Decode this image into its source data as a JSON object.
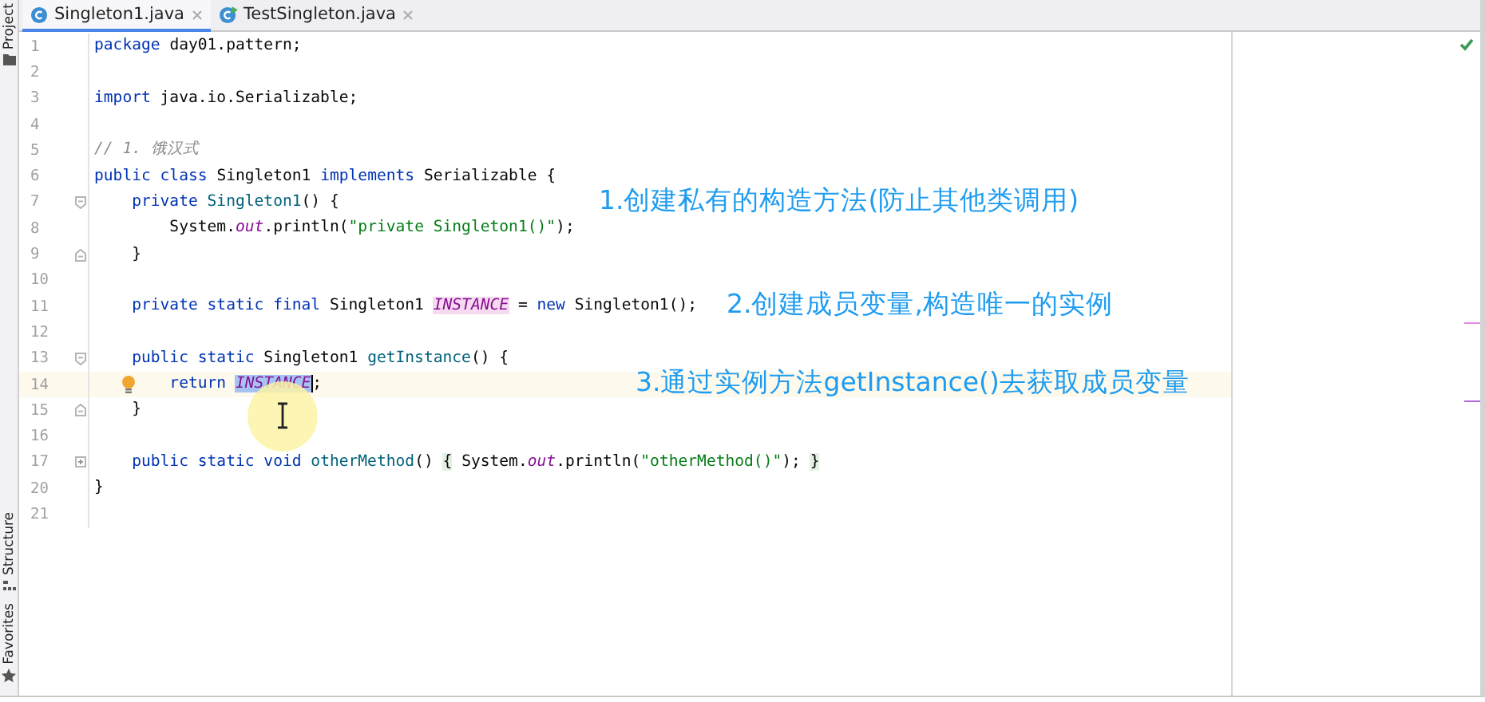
{
  "tool_windows_top": [
    {
      "label": "Project"
    }
  ],
  "tool_windows_bottom": [
    {
      "label": "Structure"
    },
    {
      "label": "Favorites"
    }
  ],
  "tabs": [
    {
      "label": "Singleton1.java",
      "selected": true,
      "kind": "class"
    },
    {
      "label": "TestSingleton.java",
      "selected": false,
      "kind": "runnable-class"
    }
  ],
  "lines": [
    {
      "number": "1",
      "current": false,
      "tokens": [
        {
          "kind": "keyword",
          "text": "package"
        },
        {
          "kind": "plain",
          "text": " day01.pattern;"
        }
      ]
    },
    {
      "number": "2",
      "current": false
    },
    {
      "number": "3",
      "current": false,
      "tokens": [
        {
          "kind": "keyword",
          "text": "import"
        },
        {
          "kind": "plain",
          "text": " java.io.Serializable;"
        }
      ]
    },
    {
      "number": "4",
      "current": false
    },
    {
      "number": "5",
      "current": false,
      "tokens": [
        {
          "kind": "comment",
          "text": "// 1. 饿汉式"
        }
      ]
    },
    {
      "number": "6",
      "current": false,
      "tokens": [
        {
          "kind": "keyword",
          "text": "public class "
        },
        {
          "kind": "plain",
          "text": "Singleton1 "
        },
        {
          "kind": "keyword",
          "text": "implements "
        },
        {
          "kind": "plain",
          "text": "Serializable {"
        }
      ]
    },
    {
      "number": "7",
      "current": false,
      "fold_marker": {
        "kind": "start"
      },
      "note": "1.创建私有的构造方法(防止其他类调用)",
      "tokens": [
        {
          "kind": "keyword",
          "text": "    private "
        },
        {
          "kind": "method",
          "text": "Singleton1"
        },
        {
          "kind": "plain",
          "text": "() {"
        }
      ]
    },
    {
      "number": "8",
      "current": false,
      "tokens": [
        {
          "kind": "plain",
          "text": "        System."
        },
        {
          "kind": "field",
          "text": "out"
        },
        {
          "kind": "plain",
          "text": ".println("
        },
        {
          "kind": "string",
          "text": "\"private Singleton1()\""
        },
        {
          "kind": "plain",
          "text": ");"
        }
      ]
    },
    {
      "number": "9",
      "current": false,
      "fold_marker": {
        "kind": "end"
      },
      "tokens": [
        {
          "kind": "plain",
          "text": "    }"
        }
      ]
    },
    {
      "number": "10",
      "current": false
    },
    {
      "number": "11",
      "current": false,
      "note": "2.创建成员变量,构造唯一的实例",
      "tokens": [
        {
          "kind": "keyword",
          "text": "    private static final "
        },
        {
          "kind": "plain",
          "text": "Singleton1 "
        },
        {
          "kind": "field",
          "text": "INSTANCE",
          "highlighted": true
        },
        {
          "kind": "plain",
          "text": " = "
        },
        {
          "kind": "keyword",
          "text": "new "
        },
        {
          "kind": "plain",
          "text": "Singleton1();"
        }
      ]
    },
    {
      "number": "12",
      "current": false
    },
    {
      "number": "13",
      "current": false,
      "fold_marker": {
        "kind": "start"
      },
      "tokens": [
        {
          "kind": "keyword",
          "text": "    public static "
        },
        {
          "kind": "plain",
          "text": "Singleton1 "
        },
        {
          "kind": "method",
          "text": "getInstance"
        },
        {
          "kind": "plain",
          "text": "() {"
        }
      ]
    },
    {
      "number": "14",
      "current": true,
      "bulb": true,
      "note": "3.通过实例方法getInstance()去获取成员变量",
      "tokens": [
        {
          "kind": "keyword",
          "text": "        return "
        },
        {
          "kind": "field",
          "text": "INSTANCE",
          "selected": true,
          "caret": true
        },
        {
          "kind": "plain",
          "text": ";"
        }
      ]
    },
    {
      "number": "15",
      "current": false,
      "fold_marker": {
        "kind": "end"
      },
      "tokens": [
        {
          "kind": "plain",
          "text": "    }"
        }
      ]
    },
    {
      "number": "16",
      "current": false
    },
    {
      "number": "17",
      "current": false,
      "fold_marker": {
        "kind": "folded"
      },
      "tokens": [
        {
          "kind": "keyword",
          "text": "    public static void "
        },
        {
          "kind": "method",
          "text": "otherMethod"
        },
        {
          "kind": "plain",
          "text": "() "
        },
        {
          "kind": "fold-brace",
          "text": "{"
        },
        {
          "kind": "plain",
          "text": " System."
        },
        {
          "kind": "field",
          "text": "out"
        },
        {
          "kind": "plain",
          "text": ".println("
        },
        {
          "kind": "string",
          "text": "\"otherMethod()\""
        },
        {
          "kind": "plain",
          "text": "); "
        },
        {
          "kind": "fold-brace",
          "text": "}"
        }
      ]
    },
    {
      "number": "20",
      "current": false,
      "tokens": [
        {
          "kind": "plain",
          "text": "}"
        }
      ]
    },
    {
      "number": "21",
      "current": false
    }
  ]
}
